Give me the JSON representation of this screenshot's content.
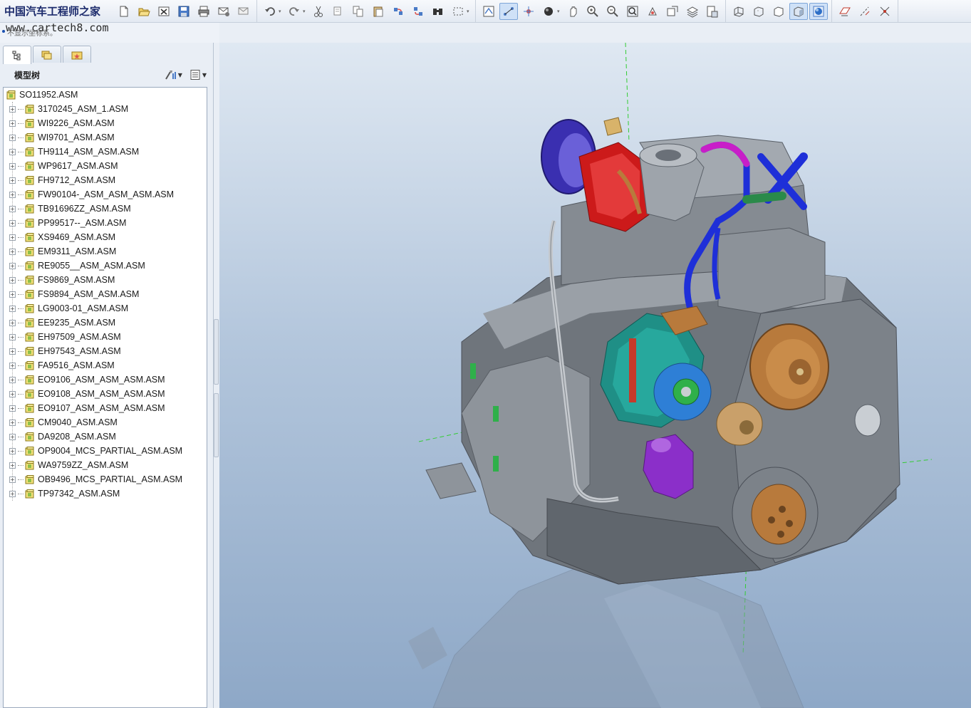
{
  "app": {
    "logo_text": "中国汽车工程师之家",
    "watermark": "www.cartech8.com",
    "status_text": "不显示坐标系。"
  },
  "toolbar": {
    "groups": [
      [
        "new-icon",
        "open-icon",
        "close-window-icon",
        "save-icon",
        "print-icon",
        "email-icon",
        "email-alt-icon"
      ],
      [
        "undo-icon",
        "redo-icon",
        "cut-icon",
        "copy-icon",
        "copy-alt-icon",
        "paste-icon",
        "regenerate-icon",
        "regenerate-manager-icon",
        "find-icon",
        "select-box-icon"
      ],
      [
        "datum-plane-display-icon",
        "datum-axis-display-icon",
        "spin-center-icon",
        "shading-icon",
        "pan-icon",
        "zoom-in-icon",
        "zoom-out-icon",
        "refit-icon",
        "reorient-icon",
        "saved-views-icon",
        "layers-icon",
        "view-manager-icon"
      ],
      [
        "wireframe-icon",
        "hidden-line-icon",
        "no-hidden-icon",
        "shaded-icon",
        "enhanced-realism-icon"
      ],
      [
        "datum-planes-icon",
        "datum-axes-icon",
        "datum-points-icon"
      ]
    ]
  },
  "panel": {
    "tabs": [
      {
        "name": "model-tree-tab",
        "icon": "model-tree-icon",
        "selected": true
      },
      {
        "name": "folder-browser-tab",
        "icon": "folder-icon",
        "selected": false
      },
      {
        "name": "favorites-tab",
        "icon": "favorites-icon",
        "selected": false
      }
    ],
    "title": "模型树",
    "root": "SO11952.ASM",
    "items": [
      "3170245_ASM_1.ASM",
      "WI9226_ASM.ASM",
      "WI9701_ASM.ASM",
      "TH9114_ASM_ASM.ASM",
      "WP9617_ASM.ASM",
      "FH9712_ASM.ASM",
      "FW90104-_ASM_ASM_ASM.ASM",
      "TB91696ZZ_ASM.ASM",
      "PP99517--_ASM.ASM",
      "XS9469_ASM.ASM",
      "EM9311_ASM.ASM",
      "RE9055__ASM_ASM.ASM",
      "FS9869_ASM.ASM",
      "FS9894_ASM_ASM.ASM",
      "LG9003-01_ASM.ASM",
      "EE9235_ASM.ASM",
      "EH97509_ASM.ASM",
      "EH97543_ASM.ASM",
      "FA9516_ASM.ASM",
      "EO9106_ASM_ASM_ASM.ASM",
      "EO9108_ASM_ASM_ASM.ASM",
      "EO9107_ASM_ASM_ASM.ASM",
      "CM9040_ASM.ASM",
      "DA9208_ASM.ASM",
      "OP9004_MCS_PARTIAL_ASM.ASM",
      "WA9759ZZ_ASM.ASM",
      "OB9496_MCS_PARTIAL_ASM.ASM",
      "TP97342_ASM.ASM"
    ]
  },
  "colors": {
    "turbo": "#cc1a1a",
    "compressor": "#3a2fb0",
    "hose": "#1e2fd8",
    "hose_accent": "#c81ec8",
    "alternator": "#1f8f86",
    "pulley": "#b87a3c",
    "pump": "#8b2fc9",
    "engine_body": "#7d8289"
  }
}
